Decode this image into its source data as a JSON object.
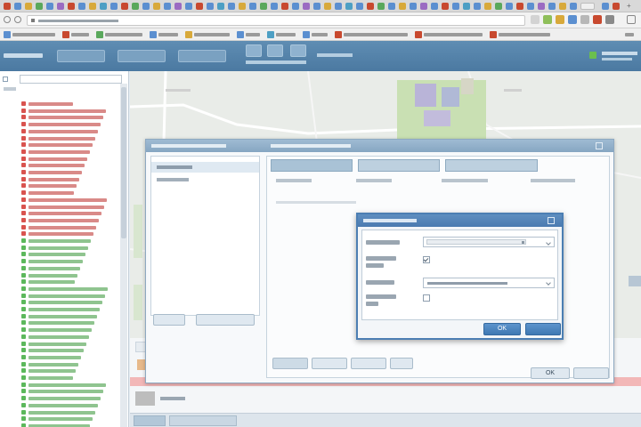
{
  "colors": {
    "header": "#4b79a1",
    "accent": "#3f78b3",
    "alert_row": "#f2b7b7"
  },
  "icons": {
    "tree_item": "map-marker-icon",
    "dialog_close": "close-icon",
    "checkbox_checked": "checkmark-icon"
  },
  "dialog_front": {
    "ok_label": "OK"
  },
  "dialog_back": {
    "ok_label": "OK"
  }
}
